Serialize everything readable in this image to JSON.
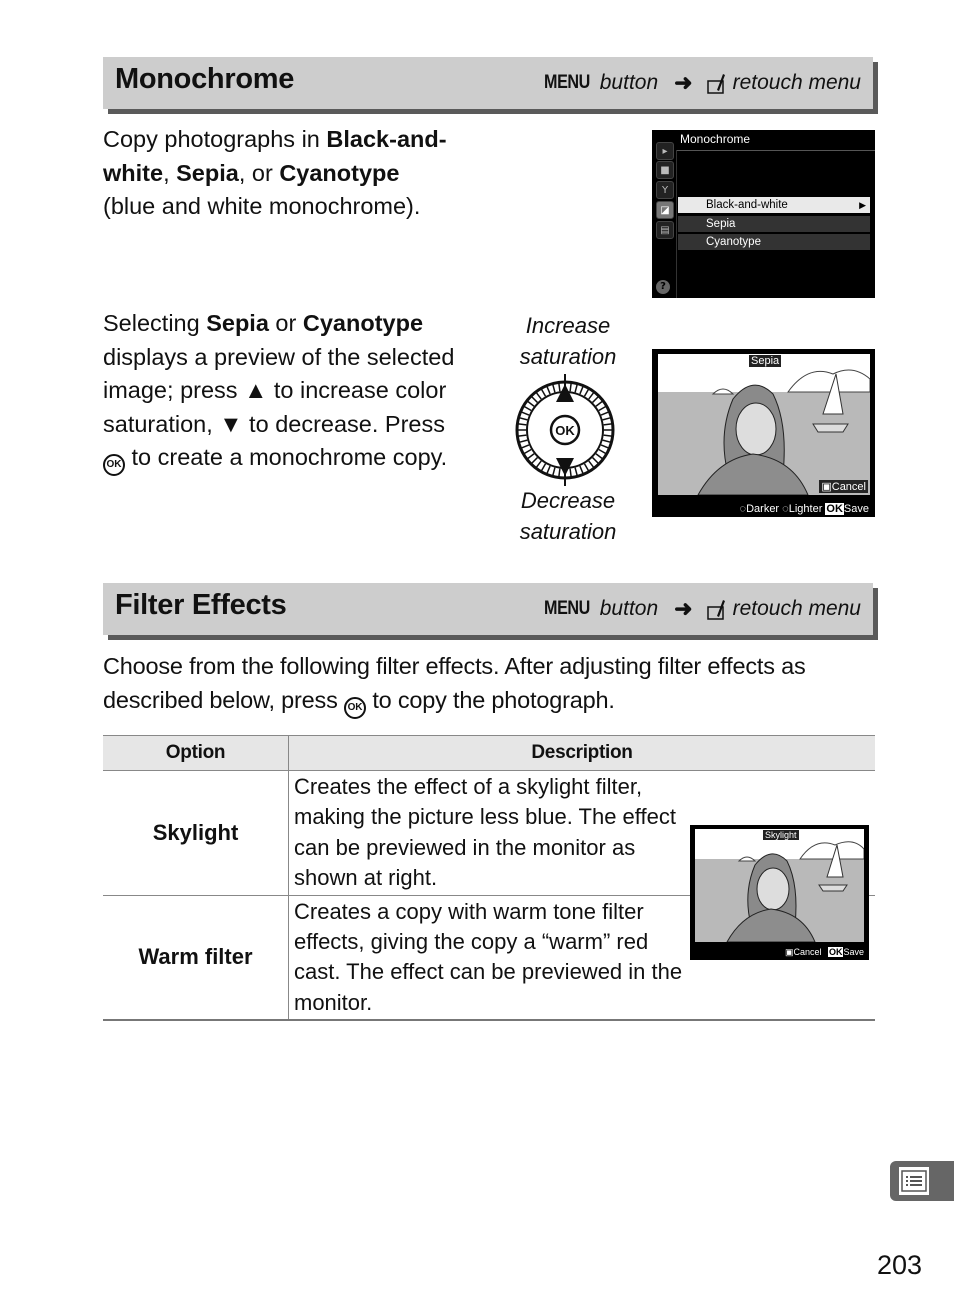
{
  "sections": [
    {
      "title": "Monochrome",
      "menu_path": {
        "menu_keyword": "MENU",
        "button_word": "button",
        "arrow": "➜",
        "menu_icon": "retouch-menu-icon",
        "menu_name": "retouch menu"
      }
    },
    {
      "title": "Filter Effects",
      "menu_path": {
        "menu_keyword": "MENU",
        "button_word": "button",
        "arrow": "➜",
        "menu_icon": "retouch-menu-icon",
        "menu_name": "retouch menu"
      }
    }
  ],
  "monochrome": {
    "intro": {
      "p1": "Copy photographs in ",
      "b1": "Black-and-white",
      "p2": ", ",
      "b2": "Sepia",
      "p3": ", or ",
      "b3": "Cyanotype",
      "p4": " (blue and white monochrome)."
    },
    "instructions": {
      "p1": "Selecting ",
      "b1": "Sepia",
      "p2": " or ",
      "b2": "Cyanotype",
      "p3": " displays a preview of the selected image; press ",
      "up_symbol": "▲",
      "p4": " to increase color saturation, ",
      "down_symbol": "▼",
      "p5": " to decrease.  Press ",
      "ok_symbol": "OK",
      "p6": " to create a monochrome copy."
    },
    "menu_screen": {
      "title": "Monochrome",
      "items": [
        "Black-and-white",
        "Sepia",
        "Cyanotype"
      ],
      "selected_index": 0,
      "side_icons": [
        "playback-icon",
        "camera-icon",
        "wrench-icon",
        "retouch-icon",
        "recent-settings-icon"
      ],
      "help_label": "?"
    },
    "multi_selector": {
      "up_label": "Increase saturation",
      "down_label": "Decrease saturation",
      "center_label": "OK"
    },
    "preview_screen": {
      "badge": "Sepia",
      "cancel": "Cancel",
      "footer": {
        "darker": "Darker",
        "lighter": "Lighter",
        "ok": "OK",
        "save": "Save"
      }
    }
  },
  "filter_effects": {
    "intro": {
      "p1": "Choose from the following filter effects.  After adjusting filter effects as described below, press ",
      "ok_symbol": "OK",
      "p2": " to copy the photograph."
    },
    "table": {
      "headers": [
        "Option",
        "Description"
      ],
      "rows": [
        {
          "option": "Skylight",
          "description": "Creates the effect of a skylight filter, making the picture less blue.  The effect can be previewed in the monitor as shown at right."
        },
        {
          "option": "Warm filter",
          "description": "Creates a copy with warm tone filter effects, giving the copy a “warm” red cast.  The effect can be previewed in the monitor."
        }
      ]
    },
    "preview_screen": {
      "badge": "Skylight",
      "footer": {
        "cancel": "Cancel",
        "ok": "OK",
        "save": "Save"
      }
    }
  },
  "side_tab": {
    "icon": "menu-list-icon"
  },
  "page_number": "203"
}
